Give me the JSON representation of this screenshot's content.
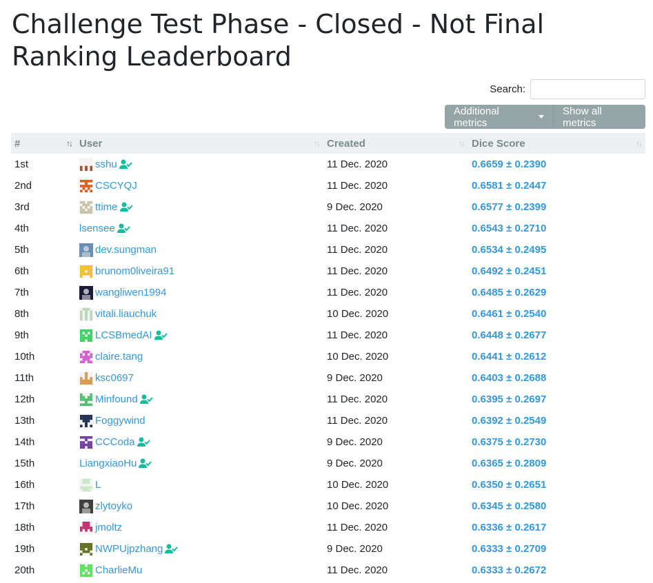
{
  "page": {
    "title": "Challenge Test Phase - Closed - Not Final Ranking Leaderboard"
  },
  "search": {
    "label": "Search:",
    "value": "",
    "placeholder": ""
  },
  "toolbar": {
    "additional_metrics_label": "Additional metrics",
    "show_all_metrics_label": "Show all metrics"
  },
  "table": {
    "columns": [
      "#",
      "User",
      "Created",
      "Dice Score"
    ],
    "rows": [
      {
        "rank": "1st",
        "user": "sshu",
        "verified": true,
        "avatar": "pattern",
        "color": "#a0522d",
        "created": "11 Dec. 2020",
        "score": "0.6659 ± 0.2390"
      },
      {
        "rank": "2nd",
        "user": "CSCYQJ",
        "verified": false,
        "avatar": "pattern",
        "color": "#e05a1a",
        "created": "11 Dec. 2020",
        "score": "0.6581 ± 0.2447"
      },
      {
        "rank": "3rd",
        "user": "ttime",
        "verified": true,
        "avatar": "pattern",
        "color": "#c8c4a8",
        "created": "9 Dec. 2020",
        "score": "0.6577 ± 0.2399"
      },
      {
        "rank": "4th",
        "user": "lsensee",
        "verified": true,
        "avatar": "none",
        "color": "",
        "created": "11 Dec. 2020",
        "score": "0.6543 ± 0.2710"
      },
      {
        "rank": "5th",
        "user": "dev.sungman",
        "verified": false,
        "avatar": "photo",
        "color": "#6a8fb5",
        "created": "11 Dec. 2020",
        "score": "0.6534 ± 0.2495"
      },
      {
        "rank": "6th",
        "user": "brunom0liveira91",
        "verified": false,
        "avatar": "pattern",
        "color": "#f0c030",
        "created": "11 Dec. 2020",
        "score": "0.6492 ± 0.2451"
      },
      {
        "rank": "7th",
        "user": "wangliwen1994",
        "verified": false,
        "avatar": "photo",
        "color": "#1a1a3a",
        "created": "11 Dec. 2020",
        "score": "0.6485 ± 0.2629"
      },
      {
        "rank": "8th",
        "user": "vitali.liauchuk",
        "verified": false,
        "avatar": "pattern",
        "color": "#b8d8b8",
        "created": "10 Dec. 2020",
        "score": "0.6461 ± 0.2540"
      },
      {
        "rank": "9th",
        "user": "LCSBmedAI",
        "verified": true,
        "avatar": "pattern",
        "color": "#40d060",
        "created": "11 Dec. 2020",
        "score": "0.6448 ± 0.2677"
      },
      {
        "rank": "10th",
        "user": "claire.tang",
        "verified": false,
        "avatar": "pattern",
        "color": "#d060d0",
        "created": "10 Dec. 2020",
        "score": "0.6441 ± 0.2612"
      },
      {
        "rank": "11th",
        "user": "ksc0697",
        "verified": false,
        "avatar": "pattern",
        "color": "#d89a50",
        "created": "9 Dec. 2020",
        "score": "0.6403 ± 0.2688"
      },
      {
        "rank": "12th",
        "user": "Minfound",
        "verified": true,
        "avatar": "pattern",
        "color": "#50c070",
        "created": "11 Dec. 2020",
        "score": "0.6395 ± 0.2697"
      },
      {
        "rank": "13th",
        "user": "Foggywind",
        "verified": false,
        "avatar": "pattern",
        "color": "#203050",
        "created": "11 Dec. 2020",
        "score": "0.6392 ± 0.2549"
      },
      {
        "rank": "14th",
        "user": "CCCoda",
        "verified": true,
        "avatar": "pattern",
        "color": "#7040a0",
        "created": "9 Dec. 2020",
        "score": "0.6375 ± 0.2730"
      },
      {
        "rank": "15th",
        "user": "LiangxiaoHu",
        "verified": true,
        "avatar": "none",
        "color": "",
        "created": "9 Dec. 2020",
        "score": "0.6365 ± 0.2809"
      },
      {
        "rank": "16th",
        "user": "L",
        "verified": false,
        "avatar": "pattern",
        "color": "#c8e8c8",
        "created": "10 Dec. 2020",
        "score": "0.6350 ± 0.2651"
      },
      {
        "rank": "17th",
        "user": "zlytoyko",
        "verified": false,
        "avatar": "photo",
        "color": "#404040",
        "created": "10 Dec. 2020",
        "score": "0.6345 ± 0.2580"
      },
      {
        "rank": "18th",
        "user": "jmoltz",
        "verified": false,
        "avatar": "pattern",
        "color": "#c03070",
        "created": "11 Dec. 2020",
        "score": "0.6336 ± 0.2617"
      },
      {
        "rank": "19th",
        "user": "NWPUjpzhang",
        "verified": true,
        "avatar": "pattern",
        "color": "#607020",
        "created": "9 Dec. 2020",
        "score": "0.6333 ± 0.2709"
      },
      {
        "rank": "20th",
        "user": "CharlieMu",
        "verified": false,
        "avatar": "pattern",
        "color": "#60e060",
        "created": "11 Dec. 2020",
        "score": "0.6333 ± 0.2672"
      }
    ]
  },
  "colors": {
    "accent": "#3498db",
    "verified": "#18bc9c",
    "button": "#95a5a6",
    "header_bg": "#ecf0f1"
  },
  "icons": {
    "sort": "sort-icon",
    "verified": "user-check-icon",
    "caret": "caret-down-icon"
  }
}
